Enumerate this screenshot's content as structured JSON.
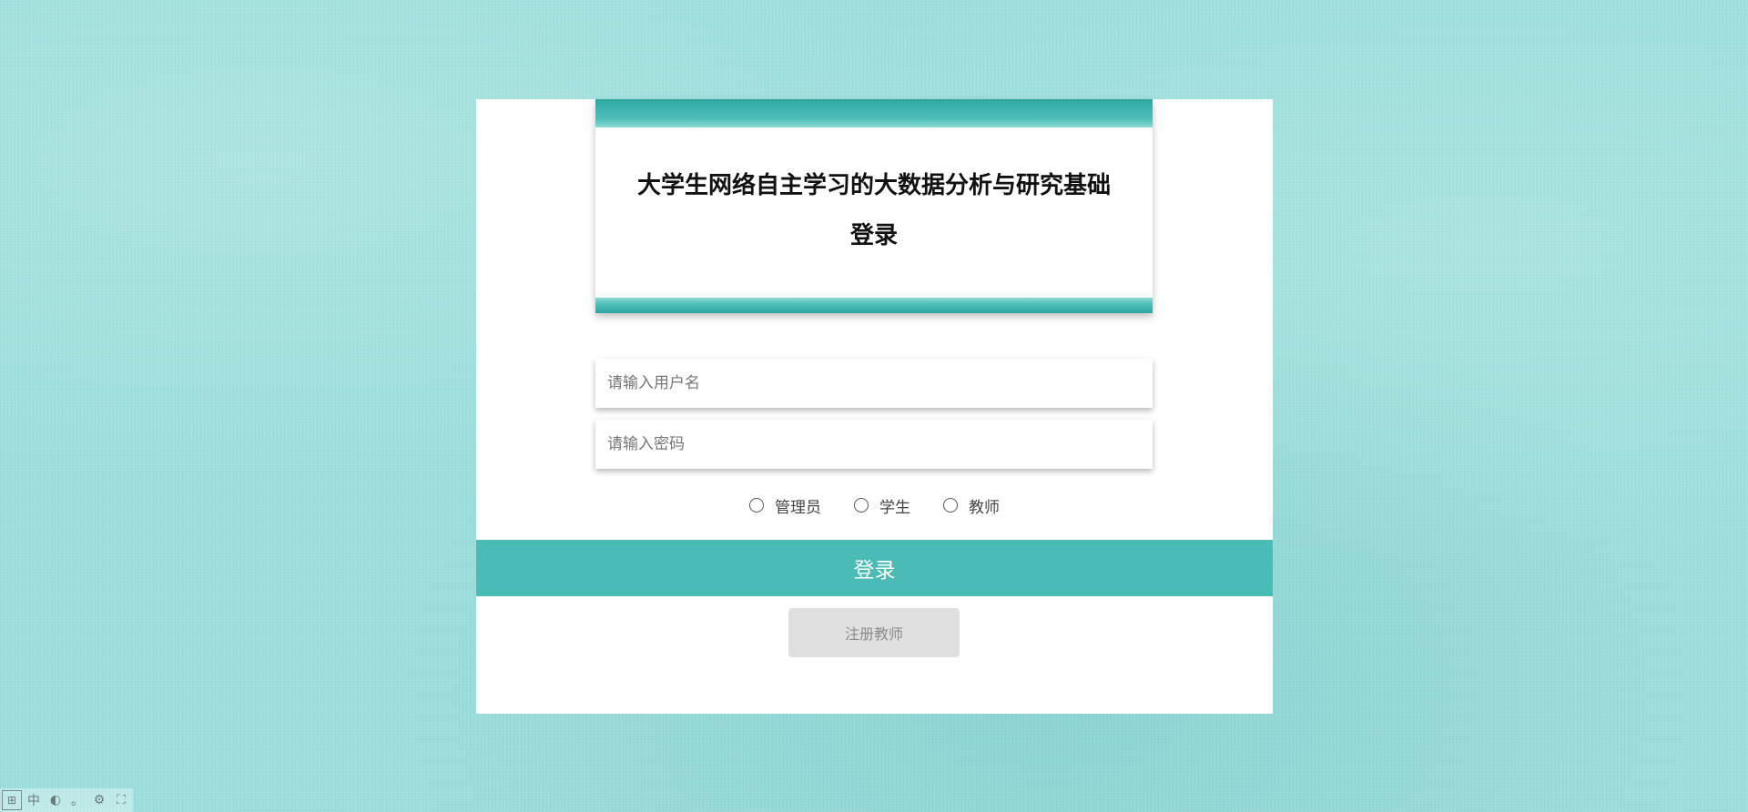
{
  "header": {
    "title_line1": "大学生网络自主学习的大数据分析与研究基础",
    "title_line2": "登录"
  },
  "form": {
    "username_placeholder": "请输入用户名",
    "password_placeholder": "请输入密码",
    "roles": [
      {
        "label": "管理员",
        "selected": false
      },
      {
        "label": "学生",
        "selected": false
      },
      {
        "label": "教师",
        "selected": false
      }
    ],
    "login_label": "登录",
    "register_label": "注册教师"
  },
  "ime_toolbar": {
    "icons": [
      "keyboard-icon",
      "chinese-mode-icon",
      "half-width-icon",
      "punctuation-icon",
      "settings-icon",
      "expand-icon"
    ],
    "glyphs": [
      "⊞",
      "中",
      "◐",
      "。",
      "⚙",
      "⛶"
    ]
  },
  "colors": {
    "background": "#9ddfdc",
    "accent": "#4bbbb6",
    "band": "#2ea7a1",
    "panel": "#ffffff",
    "register_bg": "#e0e0e0"
  }
}
